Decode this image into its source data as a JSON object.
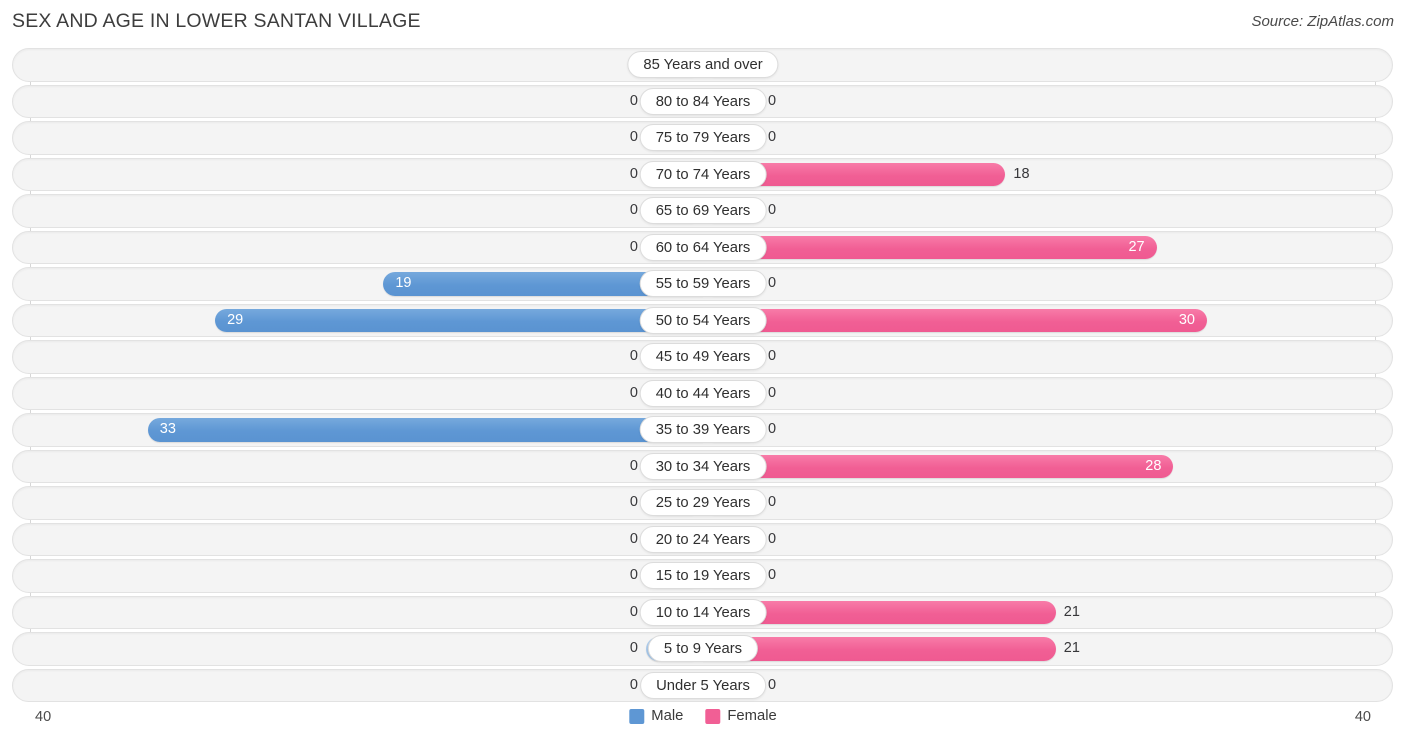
{
  "header": {
    "title": "SEX AND AGE IN LOWER SANTAN VILLAGE",
    "source": "Source: ZipAtlas.com"
  },
  "legend": {
    "male_label": "Male",
    "female_label": "Female",
    "male_color": "#5e97d4",
    "female_color": "#f15f95"
  },
  "axis": {
    "left_max": "40",
    "right_max": "40"
  },
  "chart_data": {
    "type": "bar",
    "title": "SEX AND AGE IN LOWER SANTAN VILLAGE",
    "subtype": "population-pyramid",
    "xlabel": "",
    "ylabel": "",
    "xlim": [
      0,
      40
    ],
    "grid": true,
    "legend_position": "bottom-center",
    "categories": [
      "85 Years and over",
      "80 to 84 Years",
      "75 to 79 Years",
      "70 to 74 Years",
      "65 to 69 Years",
      "60 to 64 Years",
      "55 to 59 Years",
      "50 to 54 Years",
      "45 to 49 Years",
      "40 to 44 Years",
      "35 to 39 Years",
      "30 to 34 Years",
      "25 to 29 Years",
      "20 to 24 Years",
      "15 to 19 Years",
      "10 to 14 Years",
      "5 to 9 Years",
      "Under 5 Years"
    ],
    "series": [
      {
        "name": "Male",
        "color": "#5e97d4",
        "values": [
          0,
          0,
          0,
          0,
          0,
          0,
          19,
          29,
          0,
          0,
          33,
          0,
          0,
          0,
          0,
          0,
          0,
          0
        ]
      },
      {
        "name": "Female",
        "color": "#f15f95",
        "values": [
          0,
          0,
          0,
          18,
          0,
          27,
          0,
          30,
          0,
          0,
          0,
          28,
          0,
          0,
          0,
          21,
          21,
          0
        ]
      }
    ]
  }
}
